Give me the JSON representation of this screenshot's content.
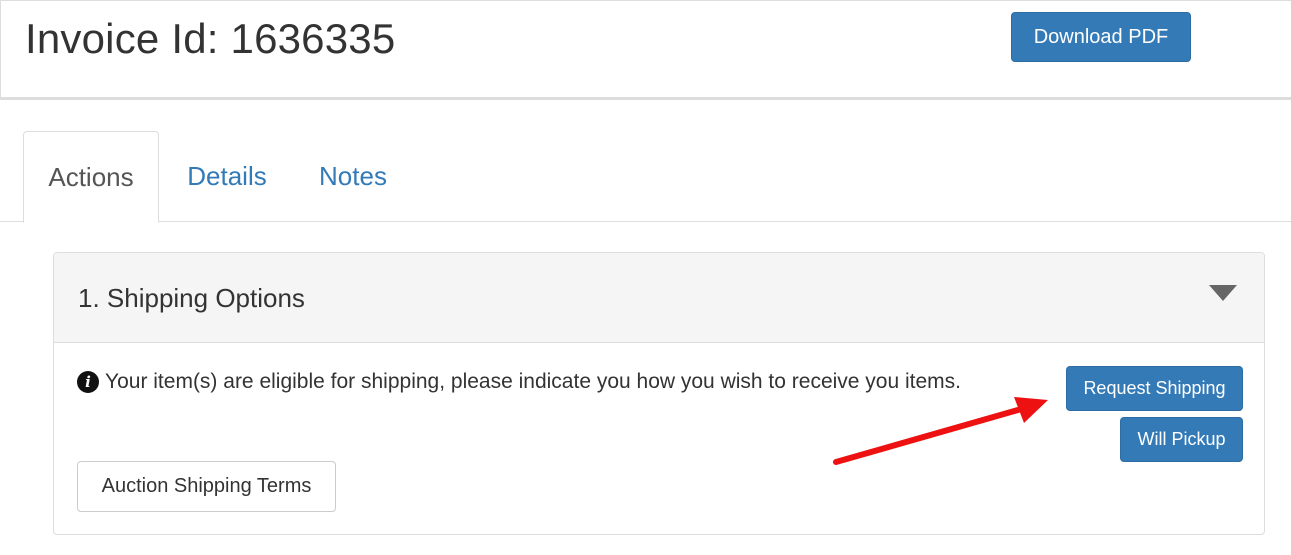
{
  "header": {
    "title": "Invoice Id: 1636335",
    "download_label": "Download PDF"
  },
  "tabs": [
    {
      "label": "Actions",
      "active": true
    },
    {
      "label": "Details",
      "active": false
    },
    {
      "label": "Notes",
      "active": false
    }
  ],
  "panel": {
    "title": "1. Shipping Options",
    "collapse_icon": "caret-down-icon",
    "info_icon": "info-circle-icon",
    "info_glyph": "i",
    "message": "Your item(s) are eligible for shipping, please indicate you how you wish to receive you items.",
    "request_shipping_label": "Request Shipping",
    "will_pickup_label": "Will Pickup",
    "terms_label": "Auction Shipping Terms"
  },
  "annotation": {
    "type": "arrow",
    "color": "#ee1111"
  },
  "colors": {
    "primary": "#337ab7",
    "link": "#337ab7",
    "panel_heading_bg": "#f5f5f5",
    "border": "#dddddd"
  }
}
